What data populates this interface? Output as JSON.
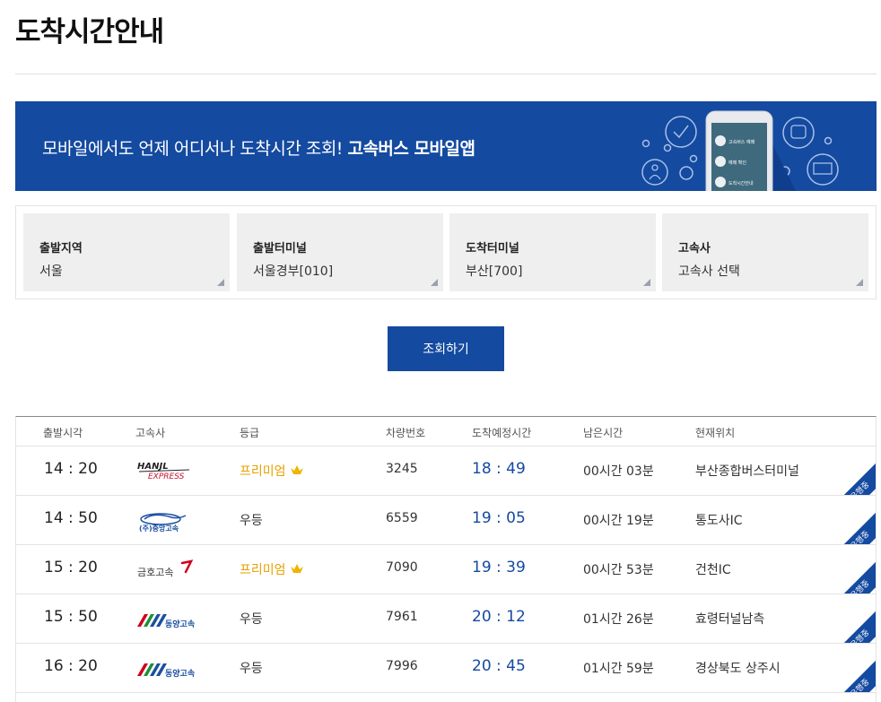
{
  "page": {
    "title": "도착시간안내"
  },
  "banner": {
    "text": "모바일에서도 언제 어디서나 도착시간 조회! ",
    "bold_text": "고속버스 모바일앱",
    "phone_menu": [
      "고속버스 예매",
      "예매 확인",
      "도착시간안내"
    ]
  },
  "search": {
    "fields": [
      {
        "label": "출발지역",
        "value": "서울"
      },
      {
        "label": "출발터미널",
        "value": "서울경부[010]"
      },
      {
        "label": "도착터미널",
        "value": "부산[700]"
      },
      {
        "label": "고속사",
        "value": "고속사 선택"
      }
    ],
    "button_label": "조회하기"
  },
  "table": {
    "headers": [
      "출발시각",
      "고속사",
      "등급",
      "차량번호",
      "도착예정시간",
      "남은시간",
      "현재위치"
    ],
    "rows": [
      {
        "departure": "14 : 20",
        "company": "HANIL EXPRESS",
        "company_logo": "hanil-logo",
        "grade": "프리미엄",
        "premium": true,
        "bus_no": "3245",
        "arrival": "18 : 49",
        "remaining": "00시간 03분",
        "location": "부산종합버스터미널",
        "status": "운행중"
      },
      {
        "departure": "14 : 50",
        "company": "중앙고속",
        "company_logo": "jungang-logo",
        "grade": "우등",
        "premium": false,
        "bus_no": "6559",
        "arrival": "19 : 05",
        "remaining": "00시간 19분",
        "location": "통도사IC",
        "status": "운행중"
      },
      {
        "departure": "15 : 20",
        "company": "금호고속",
        "company_logo": "kumho-logo",
        "grade": "프리미엄",
        "premium": true,
        "bus_no": "7090",
        "arrival": "19 : 39",
        "remaining": "00시간 53분",
        "location": "건천IC",
        "status": "운행중"
      },
      {
        "departure": "15 : 50",
        "company": "동양고속",
        "company_logo": "dongyang-logo",
        "grade": "우등",
        "premium": false,
        "bus_no": "7961",
        "arrival": "20 : 12",
        "remaining": "01시간 26분",
        "location": "효령터널남측",
        "status": "운행중"
      },
      {
        "departure": "16 : 20",
        "company": "동양고속",
        "company_logo": "dongyang-logo",
        "grade": "우등",
        "premium": false,
        "bus_no": "7996",
        "arrival": "20 : 45",
        "remaining": "01시간 59분",
        "location": "경상북도 상주시",
        "status": "운행중"
      }
    ]
  },
  "colors": {
    "brand": "#144aa0",
    "premium": "#e8a100",
    "field_bg": "#efefef"
  }
}
